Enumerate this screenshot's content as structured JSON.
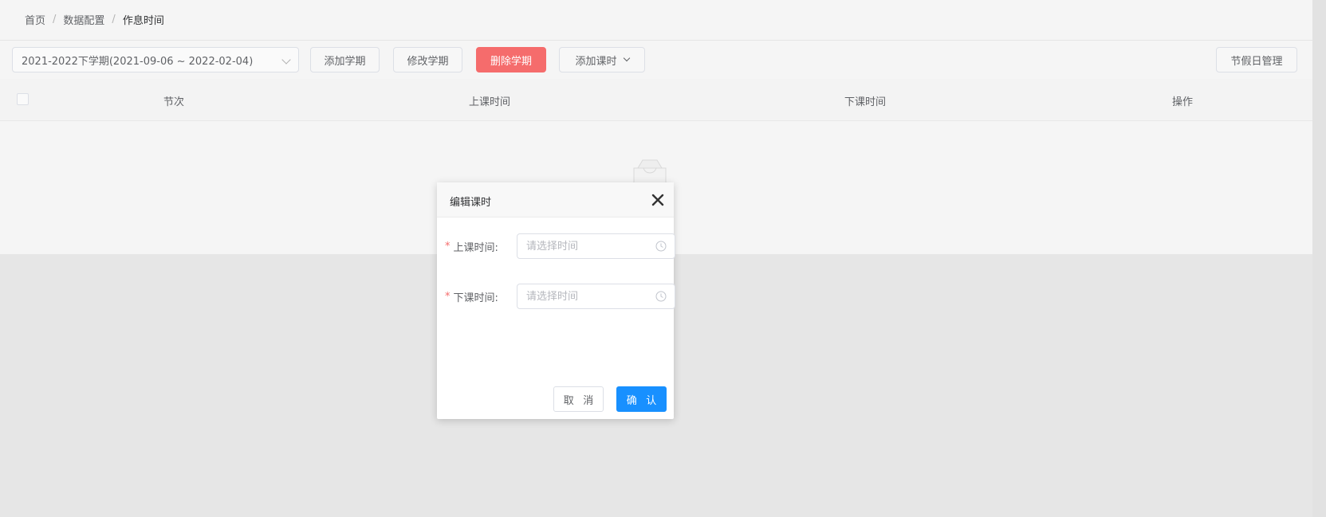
{
  "breadcrumb": {
    "items": [
      "首页",
      "数据配置",
      "作息时间"
    ],
    "separator": "/"
  },
  "toolbar": {
    "semester_select": "2021-2022下学期(2021-09-06 ~ 2022-02-04)",
    "add_semester": "添加学期",
    "edit_semester": "修改学期",
    "delete_semester": "删除学期",
    "add_period": "添加课时",
    "holiday_manage": "节假日管理"
  },
  "table": {
    "columns": [
      "节次",
      "上课时间",
      "下课时间",
      "操作"
    ]
  },
  "modal": {
    "title": "编辑课时",
    "start_label": "上课时间:",
    "start_placeholder": "请选择时间",
    "end_label": "下课时间:",
    "end_placeholder": "请选择时间",
    "required_mark": "*",
    "cancel": "取 消",
    "confirm": "确 认"
  },
  "colors": {
    "danger": "#f56c6c",
    "primary": "#1890ff"
  },
  "icons": {
    "close": "close-icon",
    "clock": "clock-icon",
    "empty": "empty-box-icon",
    "dropdown": "chevron-down-icon"
  }
}
